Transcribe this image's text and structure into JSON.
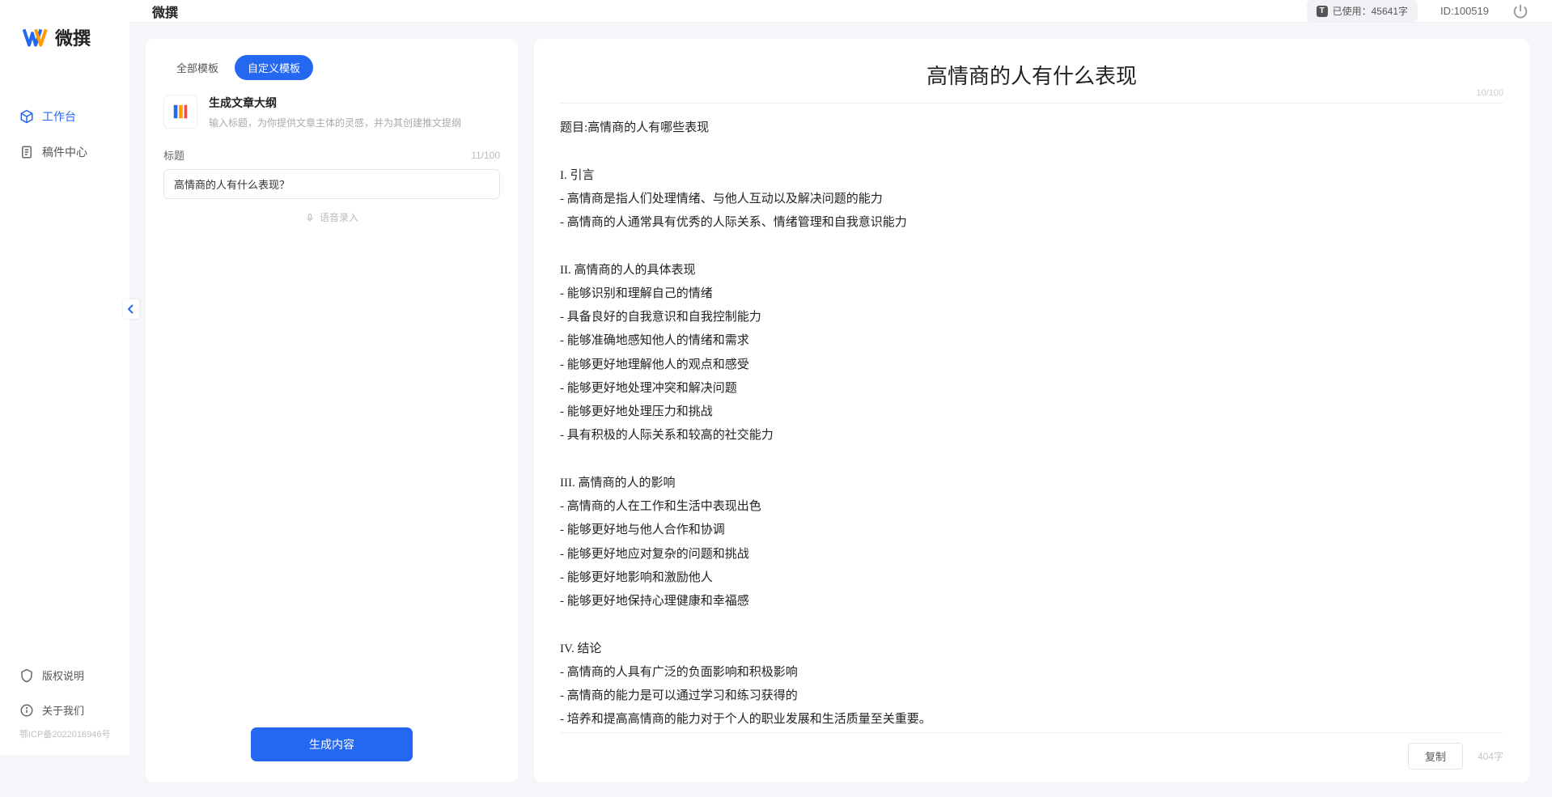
{
  "brand": {
    "name": "微撰"
  },
  "sidebar": {
    "items": [
      {
        "label": "工作台",
        "icon": "cube-icon"
      },
      {
        "label": "稿件中心",
        "icon": "doc-icon"
      }
    ],
    "bottom": [
      {
        "label": "版权说明",
        "icon": "shield-icon"
      },
      {
        "label": "关于我们",
        "icon": "info-icon"
      }
    ],
    "icp": "鄂ICP备2022016946号"
  },
  "topbar": {
    "title": "微撰",
    "usage_label": "已使用：45641字",
    "user_id": "ID:100519"
  },
  "left_panel": {
    "tabs": [
      {
        "label": "全部模板",
        "active": false
      },
      {
        "label": "自定义模板",
        "active": true
      }
    ],
    "template": {
      "name": "生成文章大纲",
      "desc": "输入标题，为你提供文章主体的灵感，并为其创建推文提纲"
    },
    "field": {
      "label": "标题",
      "value": "高情商的人有什么表现？",
      "count": "11/100"
    },
    "voice_hint": "语音录入",
    "generate_btn": "生成内容"
  },
  "right_panel": {
    "title": "高情商的人有什么表现",
    "title_counter": "10/100",
    "body": "题目:高情商的人有哪些表现\n\nI. 引言\n- 高情商是指人们处理情绪、与他人互动以及解决问题的能力\n- 高情商的人通常具有优秀的人际关系、情绪管理和自我意识能力\n\nII. 高情商的人的具体表现\n- 能够识别和理解自己的情绪\n- 具备良好的自我意识和自我控制能力\n- 能够准确地感知他人的情绪和需求\n- 能够更好地理解他人的观点和感受\n- 能够更好地处理冲突和解决问题\n- 能够更好地处理压力和挑战\n- 具有积极的人际关系和较高的社交能力\n\nIII. 高情商的人的影响\n- 高情商的人在工作和生活中表现出色\n- 能够更好地与他人合作和协调\n- 能够更好地应对复杂的问题和挑战\n- 能够更好地影响和激励他人\n- 能够更好地保持心理健康和幸福感\n\nIV. 结论\n- 高情商的人具有广泛的负面影响和积极影响\n- 高情商的能力是可以通过学习和练习获得的\n- 培养和提高高情商的能力对于个人的职业发展和生活质量至关重要。",
    "copy_btn": "复制",
    "word_count": "404字"
  }
}
